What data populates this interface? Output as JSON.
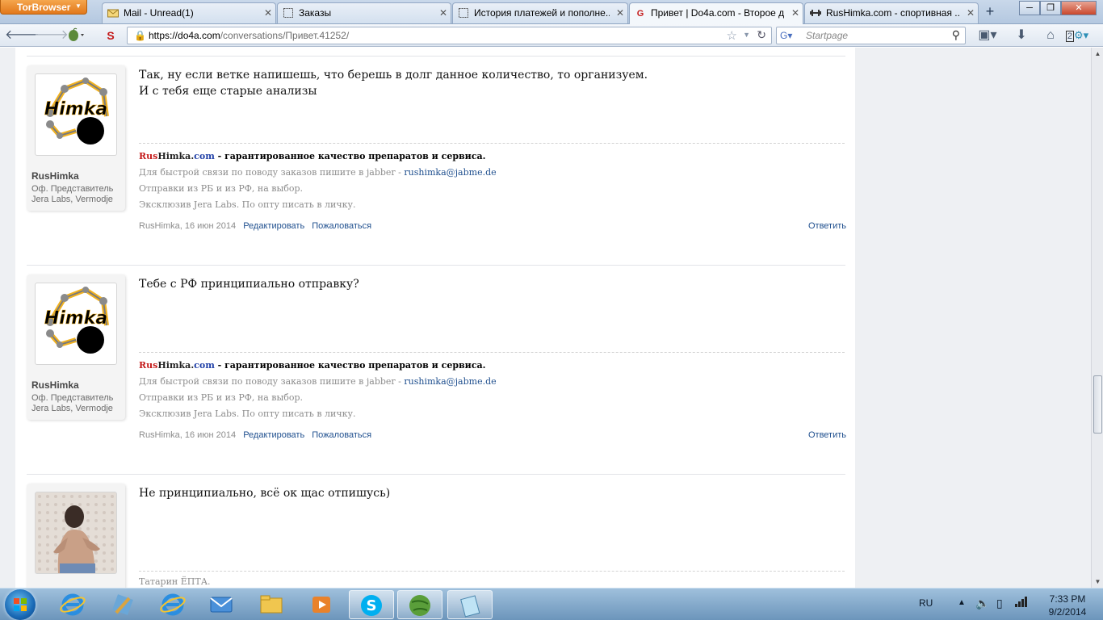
{
  "browser": {
    "tor_button_label": "TorBrowser",
    "tabs": [
      {
        "label": "Mail - Unread(1)",
        "icon": "mail-icon"
      },
      {
        "label": "Заказы",
        "icon": "page-icon"
      },
      {
        "label": "История платежей и пополне...",
        "icon": "page-icon"
      },
      {
        "label": "Привет | Do4a.com - Второе д...",
        "icon": "do4a-icon",
        "active": true
      },
      {
        "label": "RusHimka.com - спортивная ...",
        "icon": "rushimka-icon"
      }
    ],
    "url_host": "https://do4a.com",
    "url_path": "/conversations/Привет.41252/",
    "search_placeholder": "Startpage",
    "download_badge": "2"
  },
  "messages": [
    {
      "username": "RusHimka",
      "user_title_line1": "Оф. Представитель",
      "user_title_line2": "Jera Labs, Vermodje",
      "avatar": "himka-logo",
      "body_line1": "Так, ну если ветке напишешь, что берешь в долг данное количество, то организуем.",
      "body_line2": "И с тебя еще старые анализы",
      "sig_brand_rus": "Rus",
      "sig_brand_himka": "Himka",
      "sig_brand_dot": ".",
      "sig_brand_com": "com",
      "sig_tagline": " - гарантированное качество препаратов и сервиса.",
      "sig_line2_prefix": "Для быстрой связи по поводу заказов пишите в jabber - ",
      "sig_line2_link": "rushimka@jabme.de",
      "sig_line3": "Отправки из РБ и из РФ, на выбор.",
      "sig_line4": "Эксклюзив Jera Labs. По опту писать в личку.",
      "meta_author_date": "RusHimka, 16 июн 2014",
      "edit_label": "Редактировать",
      "report_label": "Пожаловаться",
      "reply_label": "Ответить"
    },
    {
      "username": "RusHimka",
      "user_title_line1": "Оф. Представитель",
      "user_title_line2": "Jera Labs, Vermodje",
      "avatar": "himka-logo",
      "body_line1": "Тебе с РФ принципиально отправку?",
      "sig_brand_rus": "Rus",
      "sig_brand_himka": "Himka",
      "sig_brand_dot": ".",
      "sig_brand_com": "com",
      "sig_tagline": " - гарантированное качество препаратов и сервиса.",
      "sig_line2_prefix": "Для быстрой связи по поводу заказов пишите в jabber - ",
      "sig_line2_link": "rushimka@jabme.de",
      "sig_line3": "Отправки из РБ и из РФ, на выбор.",
      "sig_line4": "Эксклюзив Jera Labs. По опту писать в личку.",
      "meta_author_date": "RusHimka, 16 июн 2014",
      "edit_label": "Редактировать",
      "report_label": "Пожаловаться",
      "reply_label": "Ответить"
    },
    {
      "avatar": "user-photo",
      "body_line1": "Не принципиально, всё ок щас отпишусь)",
      "sig_first_line": "Татарин ЁПТА."
    }
  ],
  "taskbar": {
    "apps": [
      "internet-explorer-icon",
      "tools-icon",
      "internet-explorer-icon",
      "mail-icon",
      "folder-icon",
      "media-player-icon",
      "skype-icon",
      "tor-globe-icon",
      "notepad-icon"
    ],
    "language": "RU",
    "time": "7:33 PM",
    "date": "9/2/2014"
  },
  "colors": {
    "brand_red": "#c41a1a",
    "brand_blue": "#2342a8",
    "link_blue": "#20508f",
    "himka_yellow": "#f2b21f"
  }
}
